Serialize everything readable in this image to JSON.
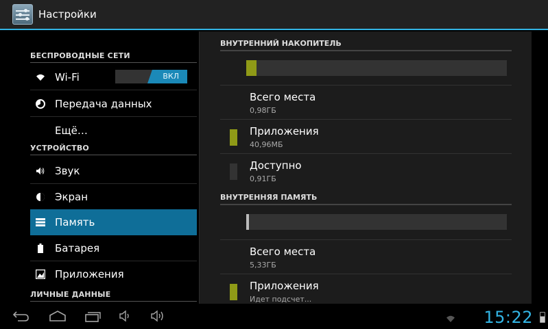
{
  "app": {
    "title": "Настройки"
  },
  "sidebar": {
    "headers": [
      "БЕСПРОВОДНЫЕ СЕТИ",
      "УСТРОЙСТВО",
      "ЛИЧНЫЕ ДАННЫЕ"
    ],
    "items": [
      {
        "label": "Wi-Fi",
        "icon": "wifi-icon"
      },
      {
        "label": "Передача данных",
        "icon": "data-usage-icon"
      },
      {
        "label": "Ещё…",
        "icon": ""
      },
      {
        "label": "Звук",
        "icon": "sound-icon"
      },
      {
        "label": "Экран",
        "icon": "display-icon"
      },
      {
        "label": "Память",
        "icon": "storage-icon"
      },
      {
        "label": "Батарея",
        "icon": "battery-icon"
      },
      {
        "label": "Приложения",
        "icon": "apps-icon"
      }
    ],
    "selected": "Память",
    "wifi_toggle": {
      "label": "ВКЛ",
      "state": "on"
    }
  },
  "storage": {
    "sections": [
      {
        "header": "ВНУТРЕННИЙ НАКОПИТЕЛЬ",
        "used_fraction": 0.04,
        "rows": [
          {
            "title": "Всего места",
            "value": "0,98ГБ"
          },
          {
            "title": "Приложения",
            "value": "40,96МБ"
          },
          {
            "title": "Доступно",
            "value": "0,91ГБ"
          }
        ]
      },
      {
        "header": "ВНУТРЕННЯЯ ПАМЯТЬ",
        "used_fraction": 0.01,
        "rows": [
          {
            "title": "Всего места",
            "value": "5,33ГБ"
          },
          {
            "title": "Приложения",
            "value": "Идет подсчет..."
          }
        ]
      }
    ]
  },
  "status": {
    "clock": "15:22"
  },
  "colors": {
    "accent": "#33b5e5",
    "selected": "#0f6e98",
    "used": "#8f9a17"
  }
}
